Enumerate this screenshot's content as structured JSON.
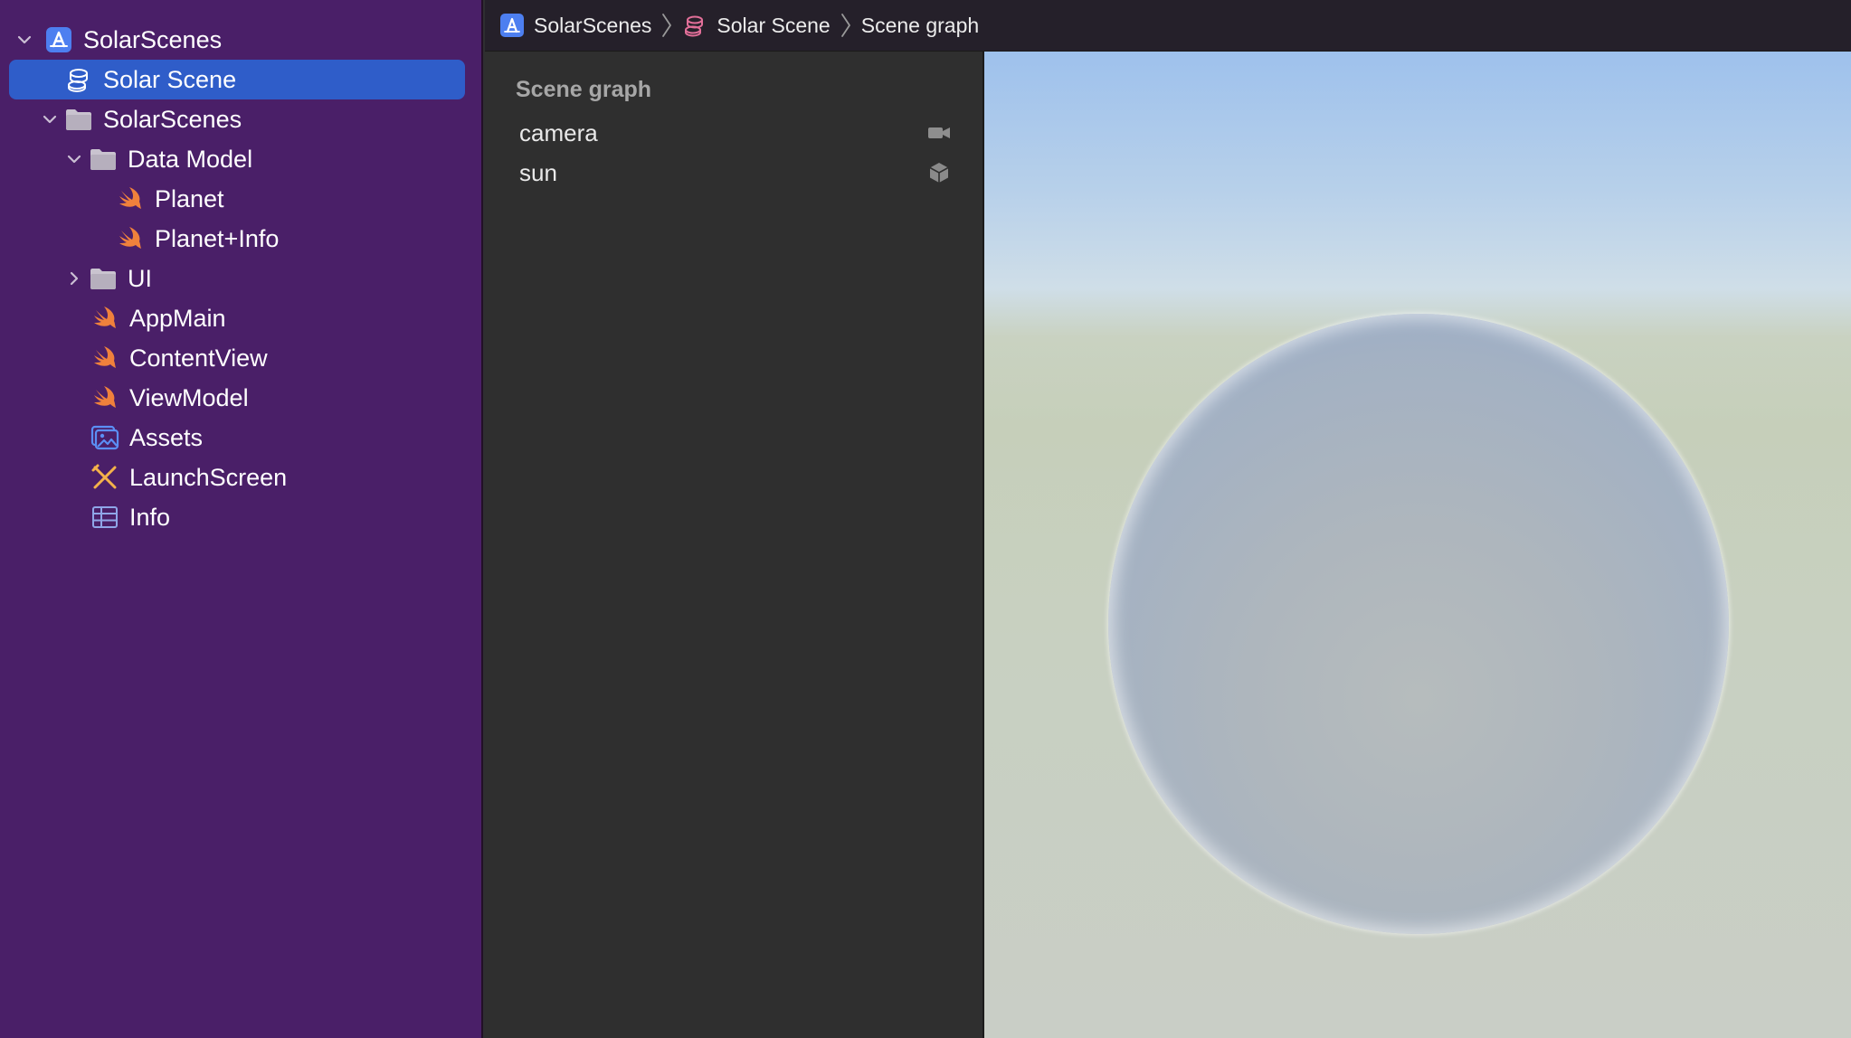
{
  "navigator": {
    "items": [
      {
        "label": "SolarScenes",
        "icon": "app-project-icon",
        "depth": 0,
        "disclosure": "expanded",
        "selected": false
      },
      {
        "label": "Solar Scene",
        "icon": "reality-composer-scene-icon",
        "depth": 1,
        "disclosure": "none",
        "selected": true
      },
      {
        "label": "SolarScenes",
        "icon": "folder-icon",
        "depth": 1,
        "disclosure": "expanded",
        "selected": false
      },
      {
        "label": "Data Model",
        "icon": "folder-icon",
        "depth": 2,
        "disclosure": "expanded",
        "selected": false
      },
      {
        "label": "Planet",
        "icon": "swift-file-icon",
        "depth": 3,
        "disclosure": "none",
        "selected": false
      },
      {
        "label": "Planet+Info",
        "icon": "swift-file-icon",
        "depth": 3,
        "disclosure": "none",
        "selected": false
      },
      {
        "label": "UI",
        "icon": "folder-icon",
        "depth": 2,
        "disclosure": "collapsed",
        "selected": false
      },
      {
        "label": "AppMain",
        "icon": "swift-file-icon",
        "depth": 2,
        "disclosure": "none",
        "selected": false
      },
      {
        "label": "ContentView",
        "icon": "swift-file-icon",
        "depth": 2,
        "disclosure": "none",
        "selected": false
      },
      {
        "label": "ViewModel",
        "icon": "swift-file-icon",
        "depth": 2,
        "disclosure": "none",
        "selected": false
      },
      {
        "label": "Assets",
        "icon": "asset-catalog-icon",
        "depth": 2,
        "disclosure": "none",
        "selected": false
      },
      {
        "label": "LaunchScreen",
        "icon": "storyboard-icon",
        "depth": 2,
        "disclosure": "none",
        "selected": false
      },
      {
        "label": "Info",
        "icon": "plist-icon",
        "depth": 2,
        "disclosure": "none",
        "selected": false
      }
    ]
  },
  "jumpbar": {
    "crumbs": [
      "SolarScenes",
      "Solar Scene",
      "Scene graph"
    ]
  },
  "scene_graph": {
    "title": "Scene graph",
    "items": [
      {
        "label": "camera",
        "icon": "video-camera-icon"
      },
      {
        "label": "sun",
        "icon": "cube-icon"
      }
    ]
  },
  "colors": {
    "sidebar_bg": "#4a1f68",
    "selection": "#2f5dc9",
    "swift_orange": "#f0813c",
    "folder": "#c7c3cc",
    "accent_blue": "#5b8ff5",
    "scene_pink": "#e26f99"
  }
}
